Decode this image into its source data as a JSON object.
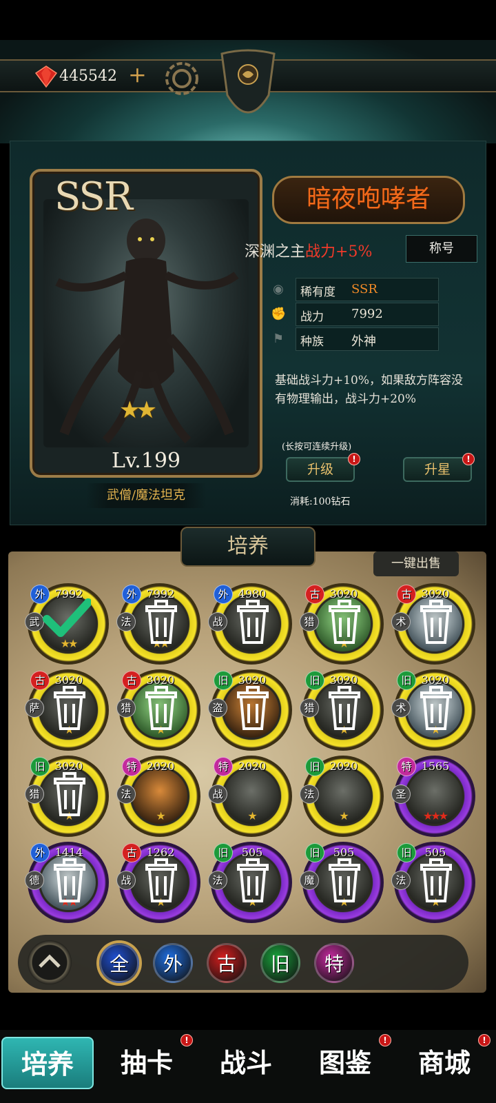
{
  "topbar": {
    "diamonds": "445542",
    "plus": "+"
  },
  "hero": {
    "rarity": "SSR",
    "level": "Lv.199",
    "stars": "★★",
    "class_tag": "武僧/魔法坦克",
    "name": "暗夜咆哮者",
    "title_prefix": "深渊之主",
    "title_buff": "战力+5%",
    "title_button": "称号",
    "stats": [
      {
        "label": "稀有度",
        "value": "SSR",
        "icon": "eye-icon"
      },
      {
        "label": "战力",
        "value": "7992",
        "icon": "fist-icon"
      },
      {
        "label": "种族",
        "value": "外神",
        "icon": "flag-icon"
      }
    ],
    "skill_desc": "基础战斗力+10%，如果敌方阵容没有物理输出，战斗力+20%",
    "hold_hint": "(长按可连续升级)",
    "upgrade_label": "升级",
    "star_up_label": "升星",
    "alert": "!",
    "cost": "消耗:100钻石"
  },
  "board": {
    "title": "培养",
    "sell_all": "一键出售",
    "slots": [
      {
        "power": "7992",
        "faction": "外",
        "cls": "武",
        "stars": "★★",
        "tier": "gold",
        "state": "selected",
        "art": "dark"
      },
      {
        "power": "7992",
        "faction": "外",
        "cls": "法",
        "stars": "★★",
        "tier": "gold",
        "state": "trash",
        "art": "dark"
      },
      {
        "power": "4980",
        "faction": "外",
        "cls": "战",
        "stars": "",
        "tier": "gold",
        "state": "trash",
        "art": "dark"
      },
      {
        "power": "3020",
        "faction": "古",
        "cls": "猎",
        "stars": "★",
        "tier": "gold",
        "state": "trash",
        "art": "green"
      },
      {
        "power": "3020",
        "faction": "古",
        "cls": "术",
        "stars": "",
        "tier": "gold",
        "state": "trash",
        "art": "pale"
      },
      {
        "power": "3020",
        "faction": "古",
        "cls": "萨",
        "stars": "★",
        "tier": "gold",
        "state": "trash",
        "art": "dark"
      },
      {
        "power": "3020",
        "faction": "古",
        "cls": "猎",
        "stars": "★",
        "tier": "gold",
        "state": "trash",
        "art": "green"
      },
      {
        "power": "3020",
        "faction": "旧",
        "cls": "盗",
        "stars": "",
        "tier": "gold",
        "state": "trash",
        "art": "orange"
      },
      {
        "power": "3020",
        "faction": "旧",
        "cls": "猎",
        "stars": "★",
        "tier": "gold",
        "state": "trash",
        "art": "dark"
      },
      {
        "power": "3020",
        "faction": "旧",
        "cls": "术",
        "stars": "★",
        "tier": "gold",
        "state": "trash",
        "art": "pale"
      },
      {
        "power": "3020",
        "faction": "旧",
        "cls": "猎",
        "stars": "★",
        "tier": "gold",
        "state": "trash",
        "art": "dark"
      },
      {
        "power": "2020",
        "faction": "特",
        "cls": "法",
        "stars": "★",
        "tier": "gold",
        "state": "none",
        "art": "orange"
      },
      {
        "power": "2020",
        "faction": "特",
        "cls": "战",
        "stars": "★",
        "tier": "gold",
        "state": "none",
        "art": "dark"
      },
      {
        "power": "2020",
        "faction": "旧",
        "cls": "法",
        "stars": "★",
        "tier": "gold",
        "state": "none",
        "art": "dark"
      },
      {
        "power": "1565",
        "faction": "特",
        "cls": "圣",
        "stars": "★★★",
        "tier": "purple",
        "state": "none",
        "art": "dark"
      },
      {
        "power": "1414",
        "faction": "外",
        "cls": "德",
        "stars": "★★",
        "tier": "purple",
        "state": "trash",
        "art": "pale"
      },
      {
        "power": "1262",
        "faction": "古",
        "cls": "战",
        "stars": "★",
        "tier": "purple",
        "state": "trash",
        "art": "dark"
      },
      {
        "power": "505",
        "faction": "旧",
        "cls": "法",
        "stars": "★",
        "tier": "purple",
        "state": "trash",
        "art": "dark"
      },
      {
        "power": "505",
        "faction": "旧",
        "cls": "魔",
        "stars": "★",
        "tier": "purple",
        "state": "trash",
        "art": "dark"
      },
      {
        "power": "505",
        "faction": "旧",
        "cls": "法",
        "stars": "★",
        "tier": "purple",
        "state": "trash",
        "art": "dark"
      }
    ]
  },
  "filters": [
    {
      "label": "全",
      "color": "#1f4fd0",
      "active": true
    },
    {
      "label": "外",
      "color": "#1f6ee0",
      "active": false
    },
    {
      "label": "古",
      "color": "#d41e1e",
      "active": false
    },
    {
      "label": "旧",
      "color": "#19a23c",
      "active": false
    },
    {
      "label": "特",
      "color": "#c42a9e",
      "active": false
    }
  ],
  "tabs": [
    {
      "label": "培养",
      "active": true,
      "alert": false
    },
    {
      "label": "抽卡",
      "active": false,
      "alert": true
    },
    {
      "label": "战斗",
      "active": false,
      "alert": false
    },
    {
      "label": "图鉴",
      "active": false,
      "alert": true
    },
    {
      "label": "商城",
      "active": false,
      "alert": true
    }
  ],
  "colors": {
    "accent_gold": "#e5d21c",
    "accent_purple": "#9a3ce0",
    "buff_red": "#f23a2a",
    "name_orange": "#f26a1b"
  }
}
